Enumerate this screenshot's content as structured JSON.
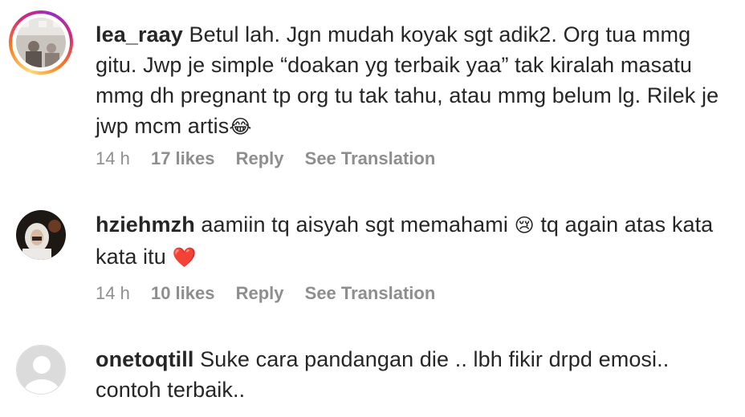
{
  "comments": [
    {
      "username": "lea_raay",
      "text": "Betul lah. Jgn mudah koyak sgt adik2. Org tua mmg gitu. Jwp je simple “doakan yg terbaik yaa” tak kiralah masatu mmg dh pregnant tp org tu tak tahu, atau mmg belum lg. Rilek je jwp mcm artis",
      "emoji": "😂",
      "time": "14 h",
      "likes": "17 likes",
      "reply_label": "Reply",
      "translate_label": "See Translation"
    },
    {
      "username": "hziehmzh",
      "text": "aamiin tq aisyah sgt memahami",
      "emoji": "😢",
      "text2": "tq again atas kata kata itu",
      "emoji2": "❤️",
      "time": "14 h",
      "likes": "10 likes",
      "reply_label": "Reply",
      "translate_label": "See Translation"
    },
    {
      "username": "onetoqtill",
      "text": "Suke cara pandangan die .. lbh fikir drpd emosi.. contoh terbaik.."
    }
  ]
}
